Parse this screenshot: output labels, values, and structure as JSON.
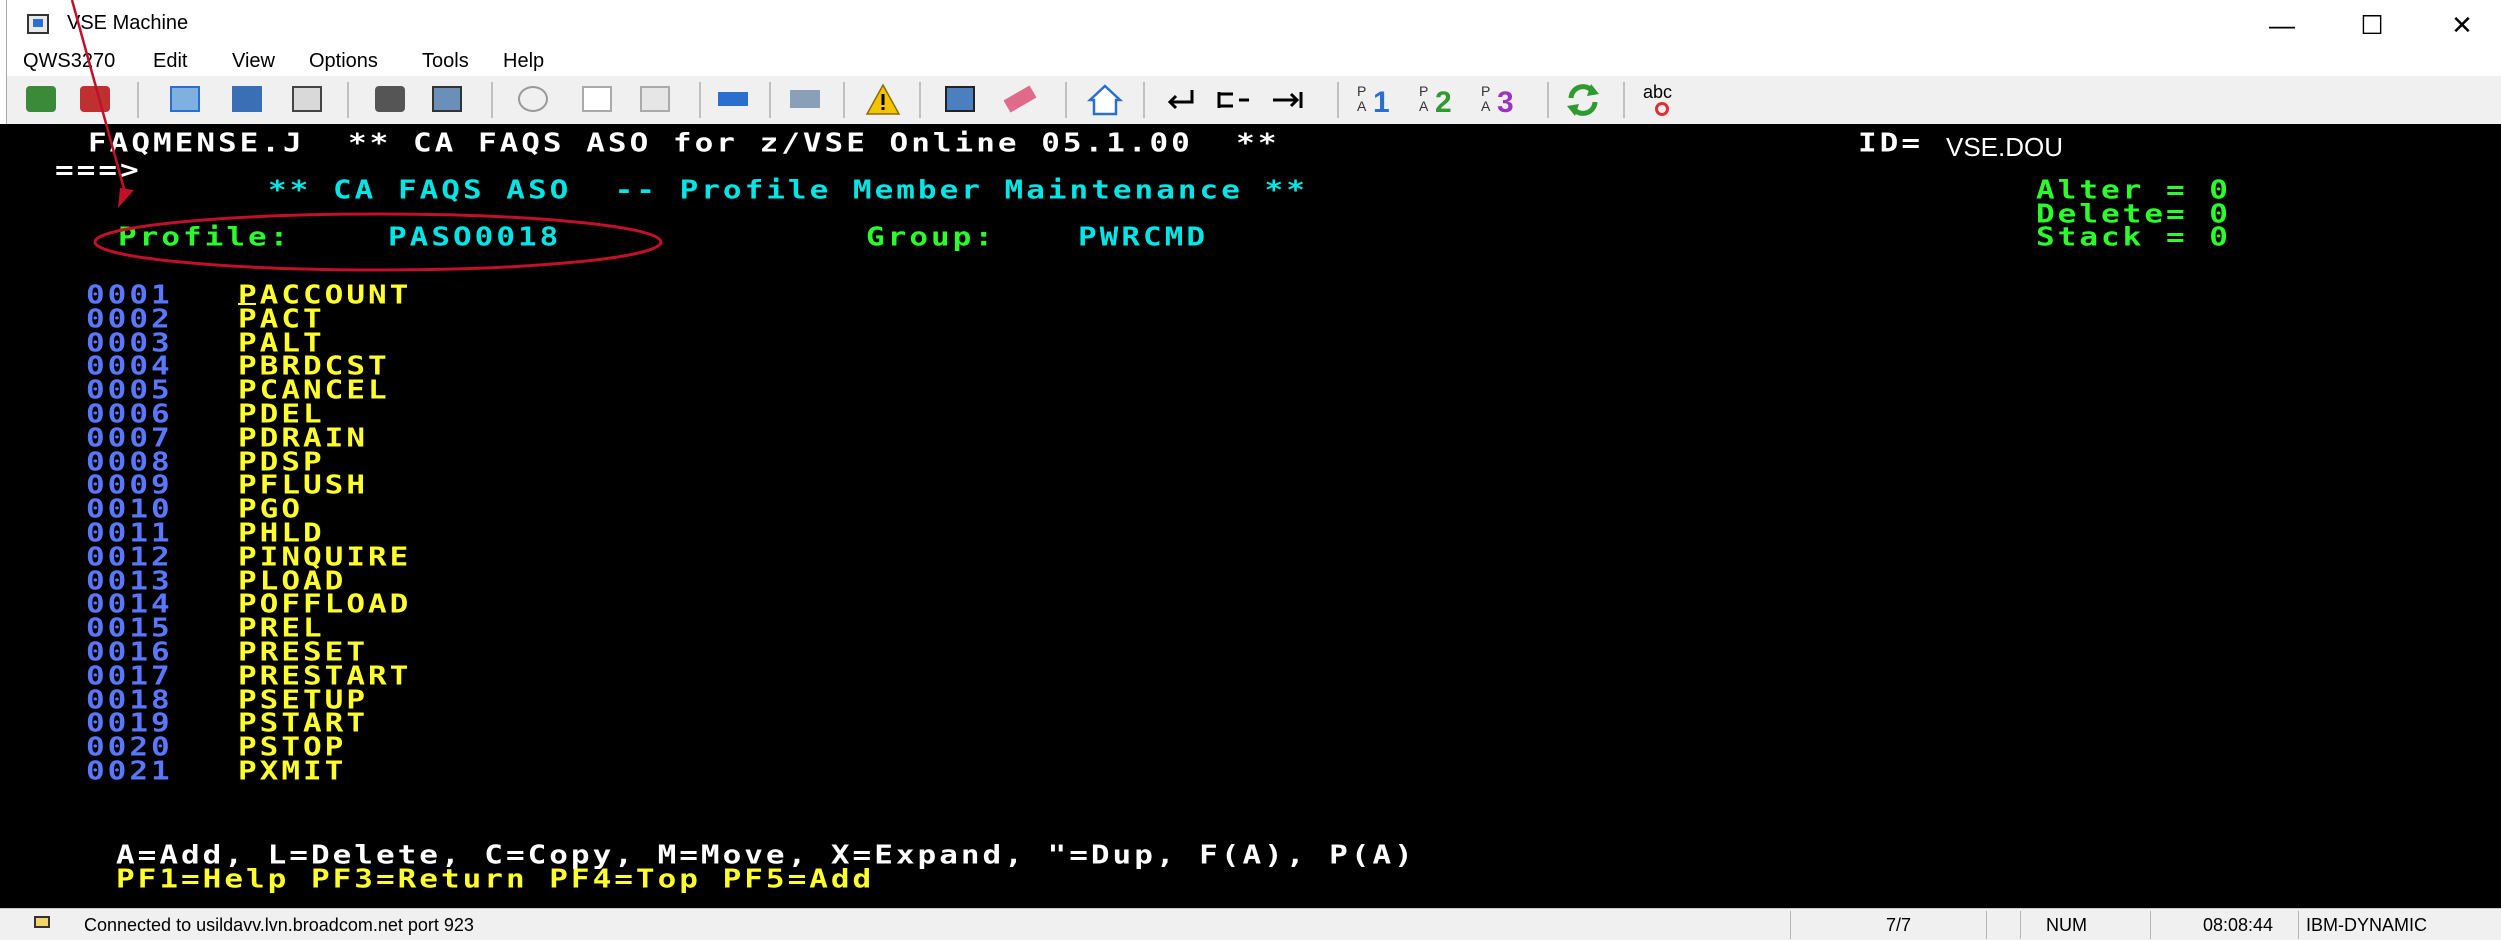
{
  "window": {
    "title": "VSE Machine",
    "minimize": "—",
    "maximize": "☐",
    "close": "✕"
  },
  "menu": {
    "items": [
      "QWS3270",
      "Edit",
      "View",
      "Options",
      "Tools",
      "Help"
    ]
  },
  "toolbar": {
    "buttons": [
      "connect-icon",
      "disconnect-icon",
      "run-macro-icon",
      "save-screen-icon",
      "print-icon",
      "camera-icon",
      "capture-icon",
      "cut-icon",
      "copy-icon",
      "paste-icon",
      "keypad-icon",
      "keyboard-icon",
      "warning-icon",
      "transfer-icon",
      "eraser-icon",
      "home-icon",
      "enter-icon",
      "tab-back-icon",
      "tab-forward-icon"
    ],
    "pa1": "1",
    "pa2": "2",
    "pa3": "3",
    "spell": "abc"
  },
  "terminal": {
    "line1": "FAQMENSE.J  ** CA FAQS ASO for z/VSE Online 05.1.00  **",
    "id_label": "ID=",
    "id_value": "VSE.DOU",
    "command_prompt": "===>",
    "title": "** CA FAQS ASO  -- Profile Member Maintenance **",
    "alter": "Alter = 0",
    "delete": "Delete= 0",
    "stack": "Stack = 0",
    "profile_label": "Profile:",
    "profile_value": "PASO0018",
    "group_label": "Group:",
    "group_value": "PWRCMD",
    "members": [
      {
        "num": "0001",
        "name": "PACCOUNT"
      },
      {
        "num": "0002",
        "name": "PACT"
      },
      {
        "num": "0003",
        "name": "PALT"
      },
      {
        "num": "0004",
        "name": "PBRDCST"
      },
      {
        "num": "0005",
        "name": "PCANCEL"
      },
      {
        "num": "0006",
        "name": "PDEL"
      },
      {
        "num": "0007",
        "name": "PDRAIN"
      },
      {
        "num": "0008",
        "name": "PDSP"
      },
      {
        "num": "0009",
        "name": "PFLUSH"
      },
      {
        "num": "0010",
        "name": "PGO"
      },
      {
        "num": "0011",
        "name": "PHLD"
      },
      {
        "num": "0012",
        "name": "PINQUIRE"
      },
      {
        "num": "0013",
        "name": "PLOAD"
      },
      {
        "num": "0014",
        "name": "POFFLOAD"
      },
      {
        "num": "0015",
        "name": "PREL"
      },
      {
        "num": "0016",
        "name": "PRESET"
      },
      {
        "num": "0017",
        "name": "PRESTART"
      },
      {
        "num": "0018",
        "name": "PSETUP"
      },
      {
        "num": "0019",
        "name": "PSTART"
      },
      {
        "num": "0020",
        "name": "PSTOP"
      },
      {
        "num": "0021",
        "name": "PXMIT"
      }
    ],
    "help_line": "A=Add, L=Delete, C=Copy, M=Move, X=Expand, \"=Dup, F(A), P(A)",
    "pf_line": "PF1=Help PF3=Return PF4=Top PF5=Add"
  },
  "status": {
    "connection": "Connected to usildavv.lvn.broadcom.net port 923",
    "position": "7/7",
    "num": "NUM",
    "time": "08:08:44",
    "model": "IBM-DYNAMIC"
  },
  "colors": {
    "terminal_bg": "#000000",
    "annotation": "#c0102a"
  }
}
